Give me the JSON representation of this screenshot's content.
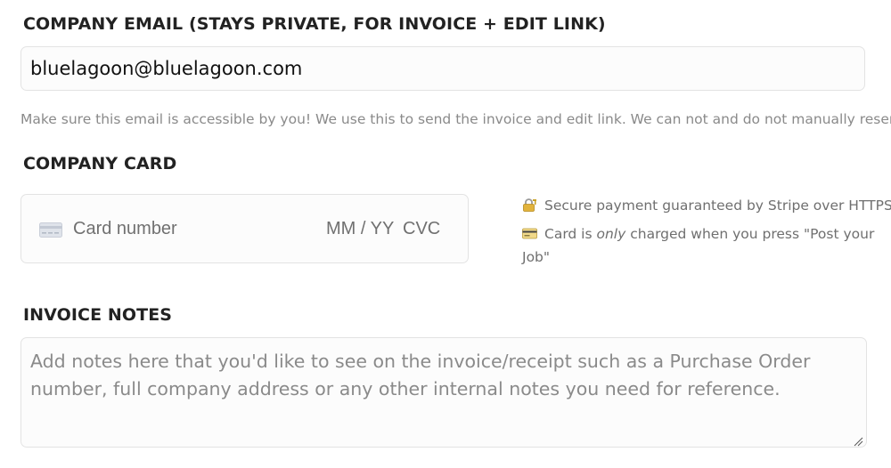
{
  "email_section": {
    "label": "COMPANY EMAIL (STAYS PRIVATE, FOR INVOICE + EDIT LINK)",
    "value": "bluelagoon@bluelagoon.com",
    "help": "Make sure this email is accessible by you! We use this to send the invoice and edit link. We can not and do not manually resend it!"
  },
  "card_section": {
    "label": "COMPANY CARD",
    "card_icon": "credit-card-icon",
    "number_placeholder": "Card number",
    "expiry_placeholder": "MM / YY",
    "cvc_placeholder": "CVC",
    "secure_icon": "lock-key-icon",
    "secure_text": "Secure payment guaranteed by Stripe over HTTPS",
    "charge_icon": "credit-card-emoji-icon",
    "charge_text_before": "Card is ",
    "charge_text_emphasis": "only",
    "charge_text_after": " charged when you press \"Post your Job\""
  },
  "notes_section": {
    "label": "INVOICE NOTES",
    "placeholder": "Add notes here that you'd like to see on the invoice/receipt such as a Purchase Order number, full company address or any other internal notes you need for reference."
  },
  "colors": {
    "label": "#222222",
    "muted_text": "#8a8a8a",
    "input_border": "#e3e3e3",
    "input_background": "#fcfcfc"
  }
}
